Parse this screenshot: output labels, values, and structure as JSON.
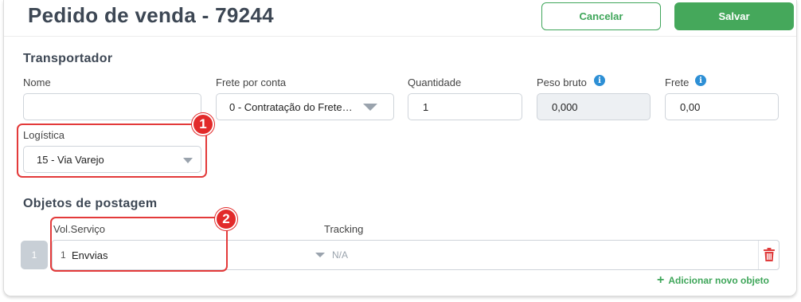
{
  "header": {
    "title": "Pedido de venda - 79244",
    "cancel_label": "Cancelar",
    "save_label": "Salvar"
  },
  "transportador": {
    "section_title": "Transportador",
    "nome": {
      "label": "Nome",
      "value": ""
    },
    "frete_por_conta": {
      "label": "Frete por conta",
      "value": "0 - Contratação do Frete…"
    },
    "quantidade": {
      "label": "Quantidade",
      "value": "1"
    },
    "peso_bruto": {
      "label": "Peso bruto",
      "value": "0,000",
      "info_icon": "info-icon"
    },
    "frete": {
      "label": "Frete",
      "value": "0,00",
      "info_icon": "info-icon"
    },
    "logistica": {
      "label": "Logística",
      "value": "15 - Via Varejo"
    }
  },
  "objetos": {
    "section_title": "Objetos de postagem",
    "col_vol_servico": "Vol.Serviço",
    "col_tracking": "Tracking",
    "rows": [
      {
        "index": "1",
        "vol": "1",
        "servico": "Envvias",
        "tracking_placeholder": "N/A"
      }
    ],
    "add_label": "Adicionar novo objeto"
  },
  "annotations": {
    "badge_1": "1",
    "badge_2": "2",
    "highlight_color": "#e33a3a"
  },
  "colors": {
    "accent_green": "#45a85b",
    "info_blue": "#2d8fd5",
    "danger_red": "#e03c3c"
  }
}
